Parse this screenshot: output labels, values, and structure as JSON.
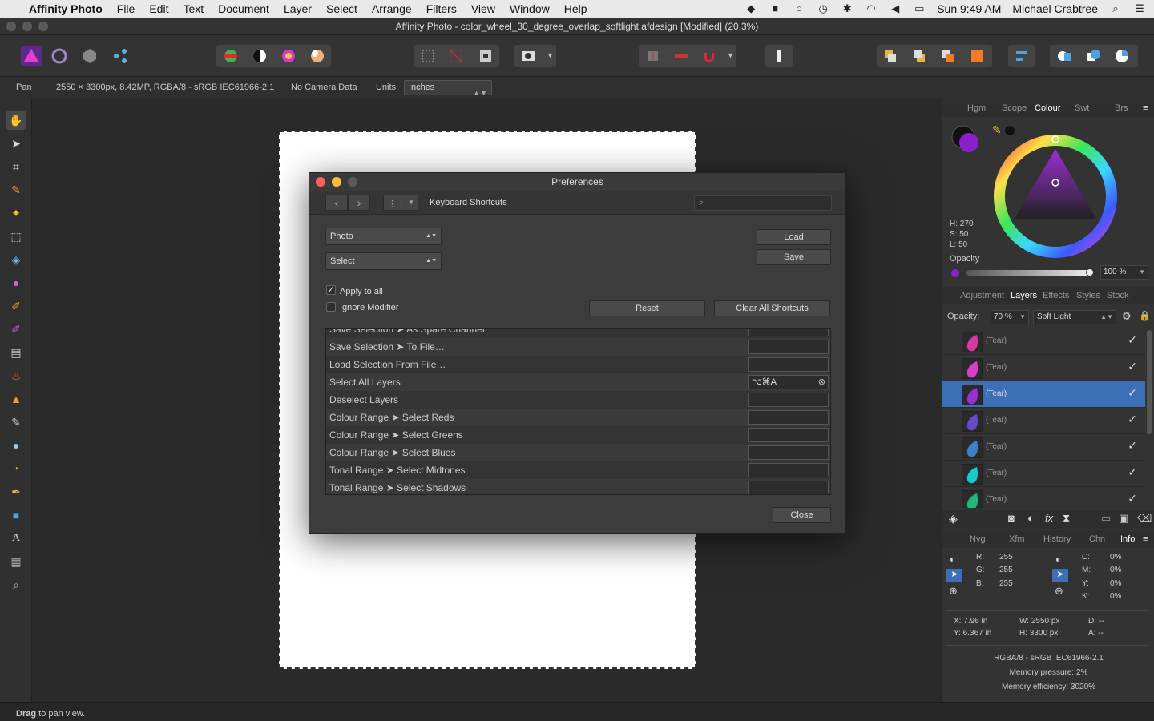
{
  "menubar": {
    "app": "Affinity Photo",
    "items": [
      "File",
      "Edit",
      "Text",
      "Document",
      "Layer",
      "Select",
      "Arrange",
      "Filters",
      "View",
      "Window",
      "Help"
    ],
    "clock": "Sun 9:49 AM",
    "user": "Michael Crabtree"
  },
  "window": {
    "title": "Affinity Photo - color_wheel_30_degree_overlap_softlight.afdesign [Modified] (20.3%)"
  },
  "context": {
    "tool": "Pan",
    "doc_info": "2550 × 3300px, 8.42MP, RGBA/8 - sRGB IEC61966-2.1",
    "camera": "No Camera Data",
    "units_label": "Units:",
    "units_value": "Inches"
  },
  "status": {
    "bold": "Drag",
    "rest": " to pan view."
  },
  "dialog": {
    "title": "Preferences",
    "section": "Keyboard Shortcuts",
    "search_placeholder": "",
    "persona_select": "Photo",
    "menu_select": "Select",
    "load": "Load",
    "save": "Save",
    "apply_all": "Apply to all",
    "apply_all_checked": "✓",
    "ignore_modifier": "Ignore Modifier",
    "reset": "Reset",
    "clear_all": "Clear All Shortcuts",
    "close": "Close",
    "shortcuts": [
      {
        "name": "Save Selection ➤ As Spare Channel",
        "key": ""
      },
      {
        "name": "Save Selection ➤ To File…",
        "key": ""
      },
      {
        "name": "Load Selection From File…",
        "key": ""
      },
      {
        "name": "Select All Layers",
        "key": "⌥⌘A"
      },
      {
        "name": "Deselect Layers",
        "key": ""
      },
      {
        "name": "Colour Range ➤ Select Reds",
        "key": ""
      },
      {
        "name": "Colour Range ➤ Select Greens",
        "key": ""
      },
      {
        "name": "Colour Range ➤ Select Blues",
        "key": ""
      },
      {
        "name": "Tonal Range ➤ Select Midtones",
        "key": ""
      },
      {
        "name": "Tonal Range ➤ Select Shadows",
        "key": ""
      }
    ]
  },
  "colour_panel": {
    "tabs": [
      "Hgm",
      "Scope",
      "Colour",
      "Swt",
      "Brs"
    ],
    "active_tab": "Colour",
    "h": "H: 270",
    "s": "S: 50",
    "l": "L: 50",
    "opacity_label": "Opacity",
    "opacity_value": "100 %",
    "fill_color": "#8b1fcc"
  },
  "layers_panel": {
    "tabs": [
      "Adjustment",
      "Layers",
      "Effects",
      "Styles",
      "Stock"
    ],
    "active_tab": "Layers",
    "opacity_label": "Opacity:",
    "opacity_value": "70 %",
    "blend_mode": "Soft Light",
    "layers": [
      {
        "name": "(Tear)",
        "color": "#d63aa0",
        "selected": false
      },
      {
        "name": "(Tear)",
        "color": "#d83fd0",
        "selected": false
      },
      {
        "name": "(Tear)",
        "color": "#9b2fd6",
        "selected": true
      },
      {
        "name": "(Tear)",
        "color": "#6a4acb",
        "selected": false
      },
      {
        "name": "(Tear)",
        "color": "#3f80cc",
        "selected": false
      },
      {
        "name": "(Tear)",
        "color": "#1cc9c9",
        "selected": false
      },
      {
        "name": "(Tear)",
        "color": "#1fba7a",
        "selected": false
      }
    ]
  },
  "info_panel": {
    "tabs": [
      "Nvg",
      "Xfm",
      "History",
      "Chn",
      "Info"
    ],
    "active_tab": "Info",
    "r": "R:",
    "r_val": "255",
    "g": "G:",
    "g_val": "255",
    "b": "B:",
    "b_val": "255",
    "c": "C:",
    "c_val": "0%",
    "m": "M:",
    "m_val": "0%",
    "y": "Y:",
    "y_val": "0%",
    "k": "K:",
    "k_val": "0%",
    "x": "X: 7.96 in",
    "ypos": "Y: 6.367 in",
    "w": "W: 2550 px",
    "h": "H: 3300 px",
    "d": "D: --",
    "a": "A: --",
    "profile": "RGBA/8 - sRGB IEC61966-2.1",
    "mem_pressure": "Memory pressure: 2%",
    "mem_eff": "Memory efficiency: 3020%"
  }
}
